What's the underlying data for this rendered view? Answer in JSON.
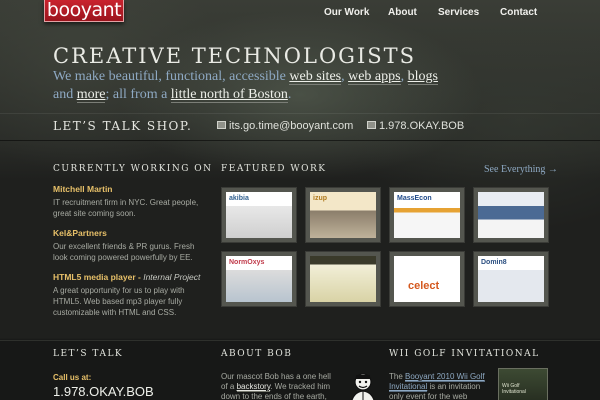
{
  "brand": {
    "logo_text": "booyant"
  },
  "nav": {
    "items": [
      "Our Work",
      "About",
      "Services",
      "Contact"
    ]
  },
  "hero": {
    "headline": "CREATIVE TECHNOLOGISTS",
    "tagline_1": "We make beautiful, functional, accessible ",
    "link_sites": "web sites",
    "sep_1": ", ",
    "link_apps": "web apps",
    "sep_2": ", ",
    "link_blogs": "blogs",
    "tagline_2": "and ",
    "link_more": "more",
    "tagline_3": "; all from a ",
    "link_boston": "little north of Boston",
    "tagline_end": "."
  },
  "talk_shop": {
    "title": "LET’S TALK SHOP.",
    "email": "its.go.time@booyant.com",
    "phone": "1.978.OKAY.BOB"
  },
  "currently_working": {
    "heading": "CURRENTLY WORKING ON",
    "items": [
      {
        "title": "Mitchell Martin",
        "subtitle": "",
        "desc": "IT recruitment firm in NYC. Great people, great site coming soon."
      },
      {
        "title": "Kel&Partners",
        "subtitle": "",
        "desc": "Our excellent friends & PR gurus. Fresh look coming powered powerfully by EE."
      },
      {
        "title": "HTML5 media player - ",
        "subtitle": "Internal Project",
        "desc": "A great opportunity for us to play with HTML5. Web based mp3 player fully customizable with HTML and CSS."
      }
    ]
  },
  "featured_work": {
    "heading": "FEATURED WORK",
    "see_all": "See Everything →",
    "thumbs": [
      {
        "label": "akibia",
        "color": "#2f5f8f"
      },
      {
        "label": "izup",
        "color": "#b07a1e"
      },
      {
        "label": "MassEcon",
        "color": "#1f4a8a"
      },
      {
        "label": "",
        "color": "#2a3a55"
      },
      {
        "label": "NormOxys",
        "color": "#c03a4a"
      },
      {
        "label": "",
        "color": "#6b7a2a"
      },
      {
        "label": "celect",
        "color": "#d4581e"
      },
      {
        "label": "Domin8",
        "color": "#2b4f80"
      }
    ]
  },
  "footer": {
    "lets_talk": {
      "heading": "LET’S TALK",
      "call_us": "Call us at:",
      "phone": "1.978.OKAY.BOB"
    },
    "about_bob": {
      "heading": "ABOUT BOB",
      "text_1": "Our mascot Bob has a one hell of a ",
      "link": "backstory",
      "text_2": ". We tracked him down to the ends of the earth, eventually"
    },
    "golf": {
      "heading": "WII GOLF INVITATIONAL",
      "text_1": "The ",
      "link": "Booyant 2010 Wii Golf Invitational",
      "text_2": " is an invitation only event for the web community",
      "poster_text": "Wii Golf Invitational"
    }
  }
}
